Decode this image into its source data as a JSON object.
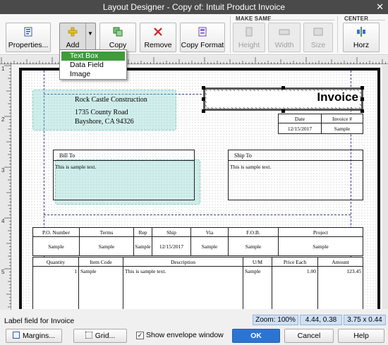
{
  "window": {
    "title": "Layout Designer - Copy of: Intuit Product Invoice",
    "close_glyph": "✕"
  },
  "toolbar": {
    "properties_label": "Properties...",
    "add_label": "Add",
    "copy_label": "Copy",
    "remove_label": "Remove",
    "copy_format_label": "Copy Format",
    "make_same_label": "MAKE SAME",
    "height_label": "Height",
    "width_label": "Width",
    "size_label": "Size",
    "center_label": "CENTER",
    "horz_label": "Horz"
  },
  "add_menu": {
    "items": [
      "Text Box",
      "Data Field",
      "Image"
    ],
    "selected": "Text Box"
  },
  "vruler_numbers": [
    "1",
    "2",
    "3",
    "4",
    "5"
  ],
  "form": {
    "company_name": "Rock Castle Construction",
    "address1": "1735 County Road",
    "address2": "Bayshore, CA 94326",
    "invoice_title": "Invoice",
    "date_header": "Date",
    "invoice_num_header": "Invoice #",
    "date_value": "12/15/2017",
    "invoice_num_value": "Sample",
    "bill_to": "Bill To",
    "ship_to": "Ship To",
    "sample_text": "This is sample text.",
    "header_cols": [
      "P.O. Number",
      "Terms",
      "Rep",
      "Ship",
      "Via",
      "F.O.B.",
      "Project"
    ],
    "header_vals": [
      "Sample",
      "Sample",
      "Sample",
      "12/15/2017",
      "Sample",
      "Sample",
      "Sample"
    ],
    "item_cols": [
      "Quantity",
      "Item Code",
      "Description",
      "U/M",
      "Price Each",
      "Amount"
    ],
    "item_vals": [
      "1",
      "Sample",
      "This is sample text.",
      "Sample",
      "1.00",
      "123.45"
    ]
  },
  "status": {
    "message": "Label field for Invoice",
    "zoom": "Zoom: 100%",
    "position": "4.44, 0.38",
    "size": "3.75 x 0.44"
  },
  "bottom": {
    "margins_label": "Margins...",
    "grid_label": "Grid...",
    "envelope_label": "Show envelope window",
    "envelope_checked": "✓",
    "ok_label": "OK",
    "cancel_label": "Cancel",
    "help_label": "Help"
  }
}
